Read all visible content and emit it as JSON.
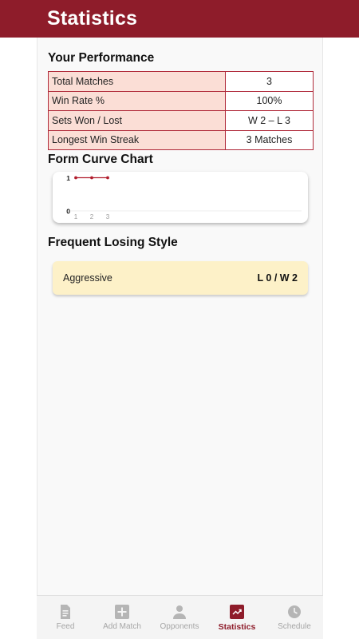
{
  "header": {
    "title": "Statistics"
  },
  "performance": {
    "title": "Your Performance",
    "rows": [
      {
        "label": "Total Matches",
        "value": "3"
      },
      {
        "label": "Win Rate %",
        "value": "100%"
      },
      {
        "label": "Sets Won / Lost",
        "value": "W 2 – L 3"
      },
      {
        "label": "Longest Win Streak",
        "value": "3 Matches"
      }
    ]
  },
  "form_curve": {
    "title": "Form Curve Chart",
    "line_color": "#b11c2c"
  },
  "chart_data": {
    "type": "line",
    "categories": [
      "1",
      "2",
      "3"
    ],
    "values": [
      1,
      1,
      1
    ],
    "ylim": [
      0,
      1
    ],
    "yticks": [
      "1",
      "0"
    ],
    "grid": true
  },
  "losing_style": {
    "title": "Frequent Losing Style",
    "items": [
      {
        "name": "Aggressive",
        "record": "L 0 / W 2"
      }
    ]
  },
  "nav": {
    "items": [
      {
        "label": "Feed",
        "icon": "feed-icon",
        "active": false
      },
      {
        "label": "Add Match",
        "icon": "add-icon",
        "active": false
      },
      {
        "label": "Opponents",
        "icon": "person-icon",
        "active": false
      },
      {
        "label": "Statistics",
        "icon": "trending-up-icon",
        "active": true
      },
      {
        "label": "Schedule",
        "icon": "clock-icon",
        "active": false
      }
    ]
  },
  "colors": {
    "brand": "#8e1c2a",
    "table_border": "#b02a3a",
    "label_cell": "#fbded6",
    "style_card": "#fdf1c8"
  }
}
